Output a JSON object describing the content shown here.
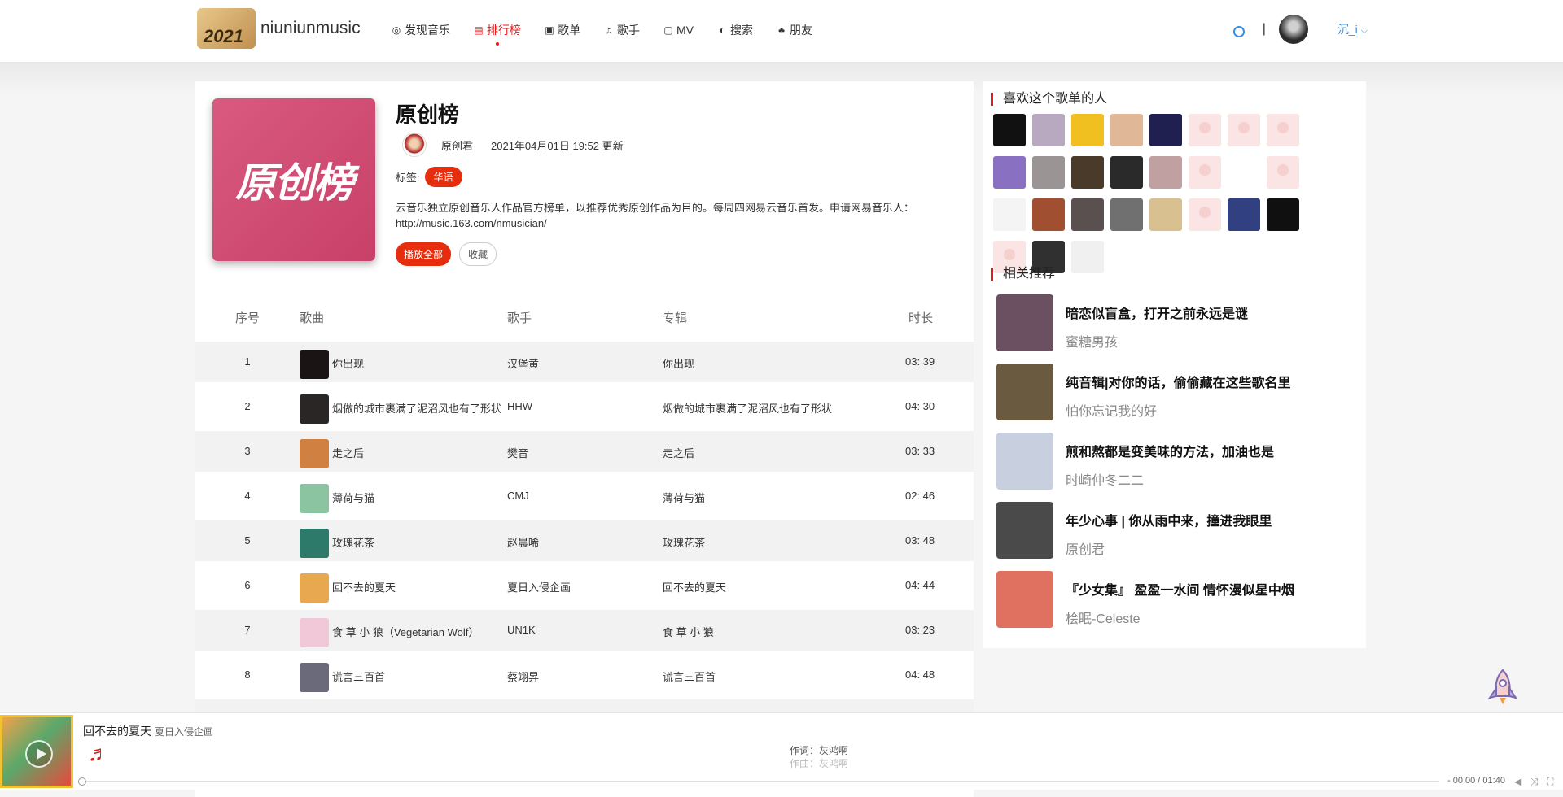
{
  "header": {
    "logo_text": "niuniunmusic",
    "logo_badge": "2021",
    "nav": [
      {
        "label": "发现音乐",
        "icon": "disc-icon",
        "glyph": "◎",
        "active": false
      },
      {
        "label": "排行榜",
        "icon": "chart-icon",
        "glyph": "▤",
        "active": true
      },
      {
        "label": "歌单",
        "icon": "playlist-icon",
        "glyph": "▣",
        "active": false
      },
      {
        "label": "歌手",
        "icon": "music-note-icon",
        "glyph": "♫",
        "active": false
      },
      {
        "label": "MV",
        "icon": "video-icon",
        "glyph": "▢",
        "active": false
      },
      {
        "label": "搜索",
        "icon": "search-icon",
        "glyph": "◐",
        "active": false
      },
      {
        "label": "朋友",
        "icon": "friends-icon",
        "glyph": "♣",
        "active": false
      }
    ],
    "separator": "|",
    "user_name": "沉_i",
    "user_dropdown": "⌵"
  },
  "playlist": {
    "cover_text": "原创榜",
    "title": "原创榜",
    "creator": "原创君",
    "updated": "2021年04月01日 19:52 更新",
    "tags_label": "标签:",
    "tags": [
      "华语"
    ],
    "description": "云音乐独立原创音乐人作品官方榜单，以推荐优秀原创作品为目的。每周四网易云音乐首发。申请网易音乐人：http://music.163.com/nmusician/",
    "play_all": "播放全部",
    "collect": "收藏"
  },
  "table": {
    "headers": {
      "index": "序号",
      "song": "歌曲",
      "artist": "歌手",
      "album": "专辑",
      "duration": "时长"
    },
    "rows": [
      {
        "index": "1",
        "song": "你出现",
        "artist": "汉堡黄",
        "album": "你出现",
        "duration": "03: 39",
        "thumb_color": "#1a1414"
      },
      {
        "index": "2",
        "song": "烟做的城市裹满了泥沼风也有了形状",
        "artist": "HHW",
        "album": "烟做的城市裹满了泥沼风也有了形状",
        "duration": "04: 30",
        "thumb_color": "#2a2626"
      },
      {
        "index": "3",
        "song": "走之后",
        "artist": "樊音",
        "album": "走之后",
        "duration": "03: 33",
        "thumb_color": "#d08040"
      },
      {
        "index": "4",
        "song": "薄荷与猫",
        "artist": "CMJ",
        "album": "薄荷与猫",
        "duration": "02: 46",
        "thumb_color": "#8bc4a0"
      },
      {
        "index": "5",
        "song": "玫瑰花茶",
        "artist": "赵晨唏",
        "album": "玫瑰花茶",
        "duration": "03: 48",
        "thumb_color": "#2e7a6a"
      },
      {
        "index": "6",
        "song": "回不去的夏天",
        "artist": "夏日入侵企画",
        "album": "回不去的夏天",
        "duration": "04: 44",
        "thumb_color": "#e8a850"
      },
      {
        "index": "7",
        "song": "食 草 小 狼（Vegetarian Wolf）",
        "artist": "UN1K",
        "album": "食 草 小 狼",
        "duration": "03: 23",
        "thumb_color": "#f0c8d8"
      },
      {
        "index": "8",
        "song": "谎言三百首",
        "artist": "蔡翊昇",
        "album": "谎言三百首",
        "duration": "04: 48",
        "thumb_color": "#6a6a7a"
      }
    ]
  },
  "sidebar": {
    "likers_title": "喜欢这个歌单的人",
    "likers": [
      {
        "color": "#111111"
      },
      {
        "color": "#b8a8c0"
      },
      {
        "color": "#f0c020"
      },
      {
        "color": "#e0b898"
      },
      {
        "color": "#202050"
      },
      {
        "color": "blank"
      },
      {
        "color": "blank"
      },
      {
        "color": "blank"
      },
      {
        "color": "#8a70c0"
      },
      {
        "color": "#9a9494"
      },
      {
        "color": "#4a3a2a"
      },
      {
        "color": "#2a2a2a"
      },
      {
        "color": "#c0a0a0"
      },
      {
        "color": "blank"
      },
      {
        "color": "#ffffff"
      },
      {
        "color": "blank"
      },
      {
        "color": "#f4f4f4"
      },
      {
        "color": "#a05030"
      },
      {
        "color": "#5a5050"
      },
      {
        "color": "#707070"
      },
      {
        "color": "#d8c090"
      },
      {
        "color": "blank"
      },
      {
        "color": "#304080"
      },
      {
        "color": "#101010"
      },
      {
        "color": "blank"
      },
      {
        "color": "#303030"
      },
      {
        "color": "#f0f0f0"
      }
    ],
    "rec_title": "相关推荐",
    "recommendations": [
      {
        "title": "暗恋似盲盒，打开之前永远是谜",
        "author": "蜜糖男孩",
        "color": "#6a5060"
      },
      {
        "title": "纯音辑|对你的话，偷偷藏在这些歌名里",
        "author": "怕你忘记我的好",
        "color": "#6a5a40"
      },
      {
        "title": "煎和熬都是变美味的方法，加油也是",
        "author": "时崎仲冬二二",
        "color": "#c8d0e0"
      },
      {
        "title": "年少心事 | 你从雨中来，撞进我眼里",
        "author": "原创君",
        "color": "#4a4a4a"
      },
      {
        "title": "『少女集』 盈盈一水间 情怀漫似星中烟",
        "author": "桧眠-Celeste",
        "color": "#e07060"
      }
    ]
  },
  "player": {
    "song": "回不去的夏天",
    "artist": "夏日入侵企画",
    "lyric_line1": "作词：灰鸿啊",
    "lyric_line2": "作曲：灰鸿啊",
    "time": "- 00:00 / 01:40",
    "progress": 0
  }
}
